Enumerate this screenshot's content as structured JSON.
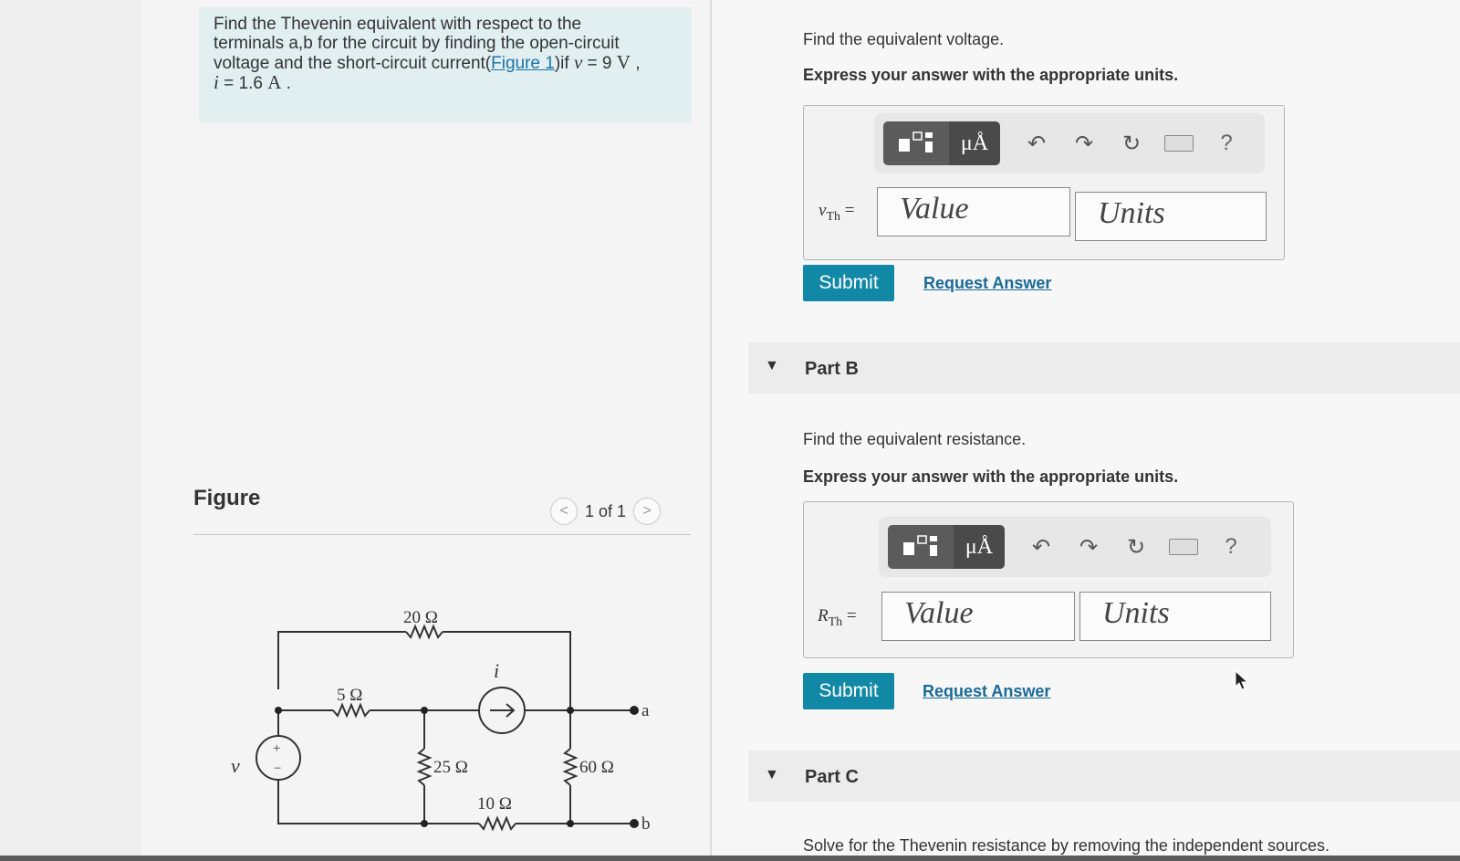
{
  "problem": {
    "line1": "Find the Thevenin equivalent with respect to the",
    "line2": "terminals a,b for the circuit by finding the open-circuit",
    "line3_pre": "voltage and the short-circuit current(",
    "figure_link": "Figure 1",
    "line3_post": ")if ",
    "v_var": "v",
    "v_eq": " = 9 ",
    "v_unit": "V",
    "sep": " ,",
    "i_var": "i",
    "i_eq": " = 1.6 ",
    "i_unit": "A",
    "end": " ."
  },
  "figure": {
    "title": "Figure",
    "pager_text": "1 of 1",
    "prev_glyph": "<",
    "next_glyph": ">"
  },
  "circuit": {
    "r1": "20 Ω",
    "r2": "5 Ω",
    "r3": "25 Ω",
    "r4": "10 Ω",
    "r5": "60 Ω",
    "source_v": "v",
    "source_i": "i",
    "plus": "+",
    "minus": "−",
    "term_a": "a",
    "term_b": "b"
  },
  "part_a": {
    "prompt": "Find the equivalent voltage.",
    "instruction": "Express your answer with the appropriate units.",
    "label_var": "v",
    "label_sub": "Th",
    "label_eq": " =",
    "value_placeholder": "Value",
    "units_placeholder": "Units",
    "submit": "Submit",
    "request": "Request Answer"
  },
  "part_b": {
    "header": "Part B",
    "prompt": "Find the equivalent resistance.",
    "instruction": "Express your answer with the appropriate units.",
    "label_var": "R",
    "label_sub": "Th",
    "label_eq": " =",
    "value_placeholder": "Value",
    "units_placeholder": "Units",
    "submit": "Submit",
    "request": "Request Answer"
  },
  "part_c": {
    "header": "Part C",
    "prompt": "Solve for the Thevenin resistance by removing the independent sources."
  },
  "toolbar": {
    "units_btn": "μÅ",
    "undo": "↶",
    "redo": "↷",
    "reset": "↻",
    "help": "?"
  },
  "colors": {
    "accent": "#1189a6",
    "link": "#1a6a98",
    "problem_bg": "#e1eff1"
  }
}
